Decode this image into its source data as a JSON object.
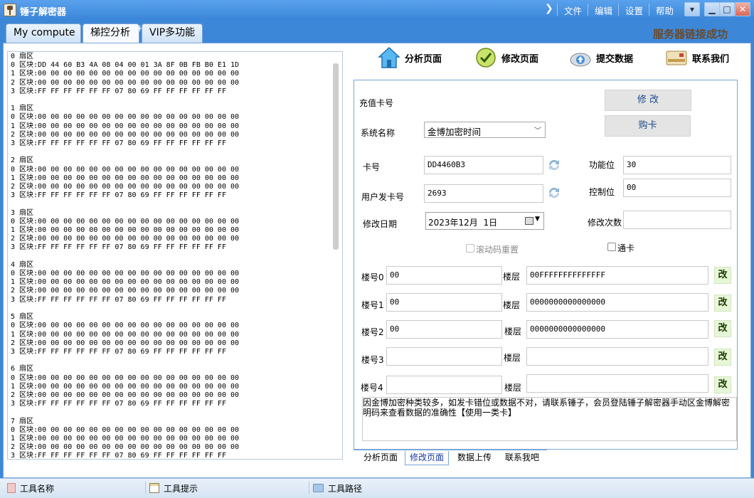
{
  "window": {
    "title": "锤子解密器",
    "menu": [
      "文件",
      "编辑",
      "设置",
      "帮助"
    ],
    "controls": {
      "restore_down": "▾",
      "minimize": "▁",
      "maximize": "□",
      "close": "✕"
    }
  },
  "tabs": [
    {
      "label": "My compute",
      "active": false
    },
    {
      "label": "梯控分析",
      "active": true
    },
    {
      "label": "VIP多功能",
      "active": false
    }
  ],
  "tab_add": "+",
  "server_status": "服务器链接成功",
  "dump": {
    "text": "0 扇区\n0 区块:DD 44 60 B3 4A 08 04 00 01 3A 8F 0B FB B0 E1 1D\n1 区块:00 00 00 00 00 00 00 00 00 00 00 00 00 00 00 00\n2 区块:00 00 00 00 00 00 00 00 00 00 00 00 00 00 00 00\n3 区块:FF FF FF FF FF FF 07 80 69 FF FF FF FF FF FF\n\n1 扇区\n0 区块:00 00 00 00 00 00 00 00 00 00 00 00 00 00 00 00\n1 区块:00 00 00 00 00 00 00 00 00 00 00 00 00 00 00 00\n2 区块:00 00 00 00 00 00 00 00 00 00 00 00 00 00 00 00\n3 区块:FF FF FF FF FF FF 07 80 69 FF FF FF FF FF FF\n\n2 扇区\n0 区块:00 00 00 00 00 00 00 00 00 00 00 00 00 00 00 00\n1 区块:00 00 00 00 00 00 00 00 00 00 00 00 00 00 00 00\n2 区块:00 00 00 00 00 00 00 00 00 00 00 00 00 00 00 00\n3 区块:FF FF FF FF FF FF 07 80 69 FF FF FF FF FF FF\n\n3 扇区\n0 区块:00 00 00 00 00 00 00 00 00 00 00 00 00 00 00 00\n1 区块:00 00 00 00 00 00 00 00 00 00 00 00 00 00 00 00\n2 区块:00 00 00 00 00 00 00 00 00 00 00 00 00 00 00 00\n3 区块:FF FF FF FF FF FF 07 80 69 FF FF FF FF FF FF\n\n4 扇区\n0 区块:00 00 00 00 00 00 00 00 00 00 00 00 00 00 00 00\n1 区块:00 00 00 00 00 00 00 00 00 00 00 00 00 00 00 00\n2 区块:00 00 00 00 00 00 00 00 00 00 00 00 00 00 00 00\n3 区块:FF FF FF FF FF FF 07 80 69 FF FF FF FF FF FF\n\n5 扇区\n0 区块:00 00 00 00 00 00 00 00 00 00 00 00 00 00 00 00\n1 区块:00 00 00 00 00 00 00 00 00 00 00 00 00 00 00 00\n2 区块:00 00 00 00 00 00 00 00 00 00 00 00 00 00 00 00\n3 区块:FF FF FF FF FF FF 07 80 69 FF FF FF FF FF FF\n\n6 扇区\n0 区块:00 00 00 00 00 00 00 00 00 00 00 00 00 00 00 00\n1 区块:00 00 00 00 00 00 00 00 00 00 00 00 00 00 00 00\n2 区块:00 00 00 00 00 00 00 00 00 00 00 00 00 00 00 00\n3 区块:FF FF FF FF FF FF 07 80 69 FF FF FF FF FF FF\n\n7 扇区\n0 区块:00 00 00 00 00 00 00 00 00 00 00 00 00 00 00 00\n1 区块:00 00 00 00 00 00 00 00 00 00 00 00 00 00 00 00\n2 区块:00 00 00 00 00 00 00 00 00 00 00 00 00 00 00 00\n3 区块:FF FF FF FF FF FF 07 80 69 FF FF FF FF FF FF"
  },
  "toolbar": [
    {
      "label": "分析页面",
      "icon": "home-icon"
    },
    {
      "label": "修改页面",
      "icon": "checkmark-icon"
    },
    {
      "label": "提交数据",
      "icon": "cloud-upload-icon"
    },
    {
      "label": "联系我们",
      "icon": "contact-card-icon"
    }
  ],
  "form": {
    "recharge_label": "充值卡号",
    "modify_button": "修 改",
    "buy_card_button": "购卡",
    "system_label": "系统名称",
    "system_value": "金博加密时间",
    "card_no_label": "卡号",
    "card_no_value": "DD4460B3",
    "function_bit_label": "功能位",
    "function_bit_value": "30",
    "user_card_label": "用户发卡号",
    "user_card_value": "2693",
    "control_bit_label": "控制位",
    "control_bit_value": "00",
    "date_label": "修改日期",
    "date_value": "2023年12月  1日",
    "count_label": "修改次数",
    "count_value": "",
    "rolling_code_label": "滚动码重置",
    "universal_card_label": "通卡",
    "change_button": "改",
    "floor_label": "楼层",
    "buildings": [
      {
        "label": "楼号0",
        "value": "00",
        "floor": "00FFFFFFFFFFFFFF"
      },
      {
        "label": "楼号1",
        "value": "00",
        "floor": "0000000000000000"
      },
      {
        "label": "楼号2",
        "value": "00",
        "floor": "0000000000000000"
      },
      {
        "label": "楼号3",
        "value": "",
        "floor": ""
      },
      {
        "label": "楼号4",
        "value": "",
        "floor": ""
      }
    ],
    "notice": "因金博加密种类较多，如发卡错位或数据不对，请联系锤子，会员登陆锤子解密器手动区金博解密明码来查看数据的准确性【使用一类卡】"
  },
  "bottom_tabs": [
    {
      "label": "分析页面",
      "active": false
    },
    {
      "label": "修改页面",
      "active": true
    },
    {
      "label": "数据上传",
      "active": false
    },
    {
      "label": "联系我吧",
      "active": false
    }
  ],
  "statusbar": [
    {
      "label": "工具名称",
      "icon": "app-logo-icon"
    },
    {
      "label": "工具提示",
      "icon": "notepad-icon"
    },
    {
      "label": "工具路径",
      "icon": "folder-icon"
    }
  ]
}
